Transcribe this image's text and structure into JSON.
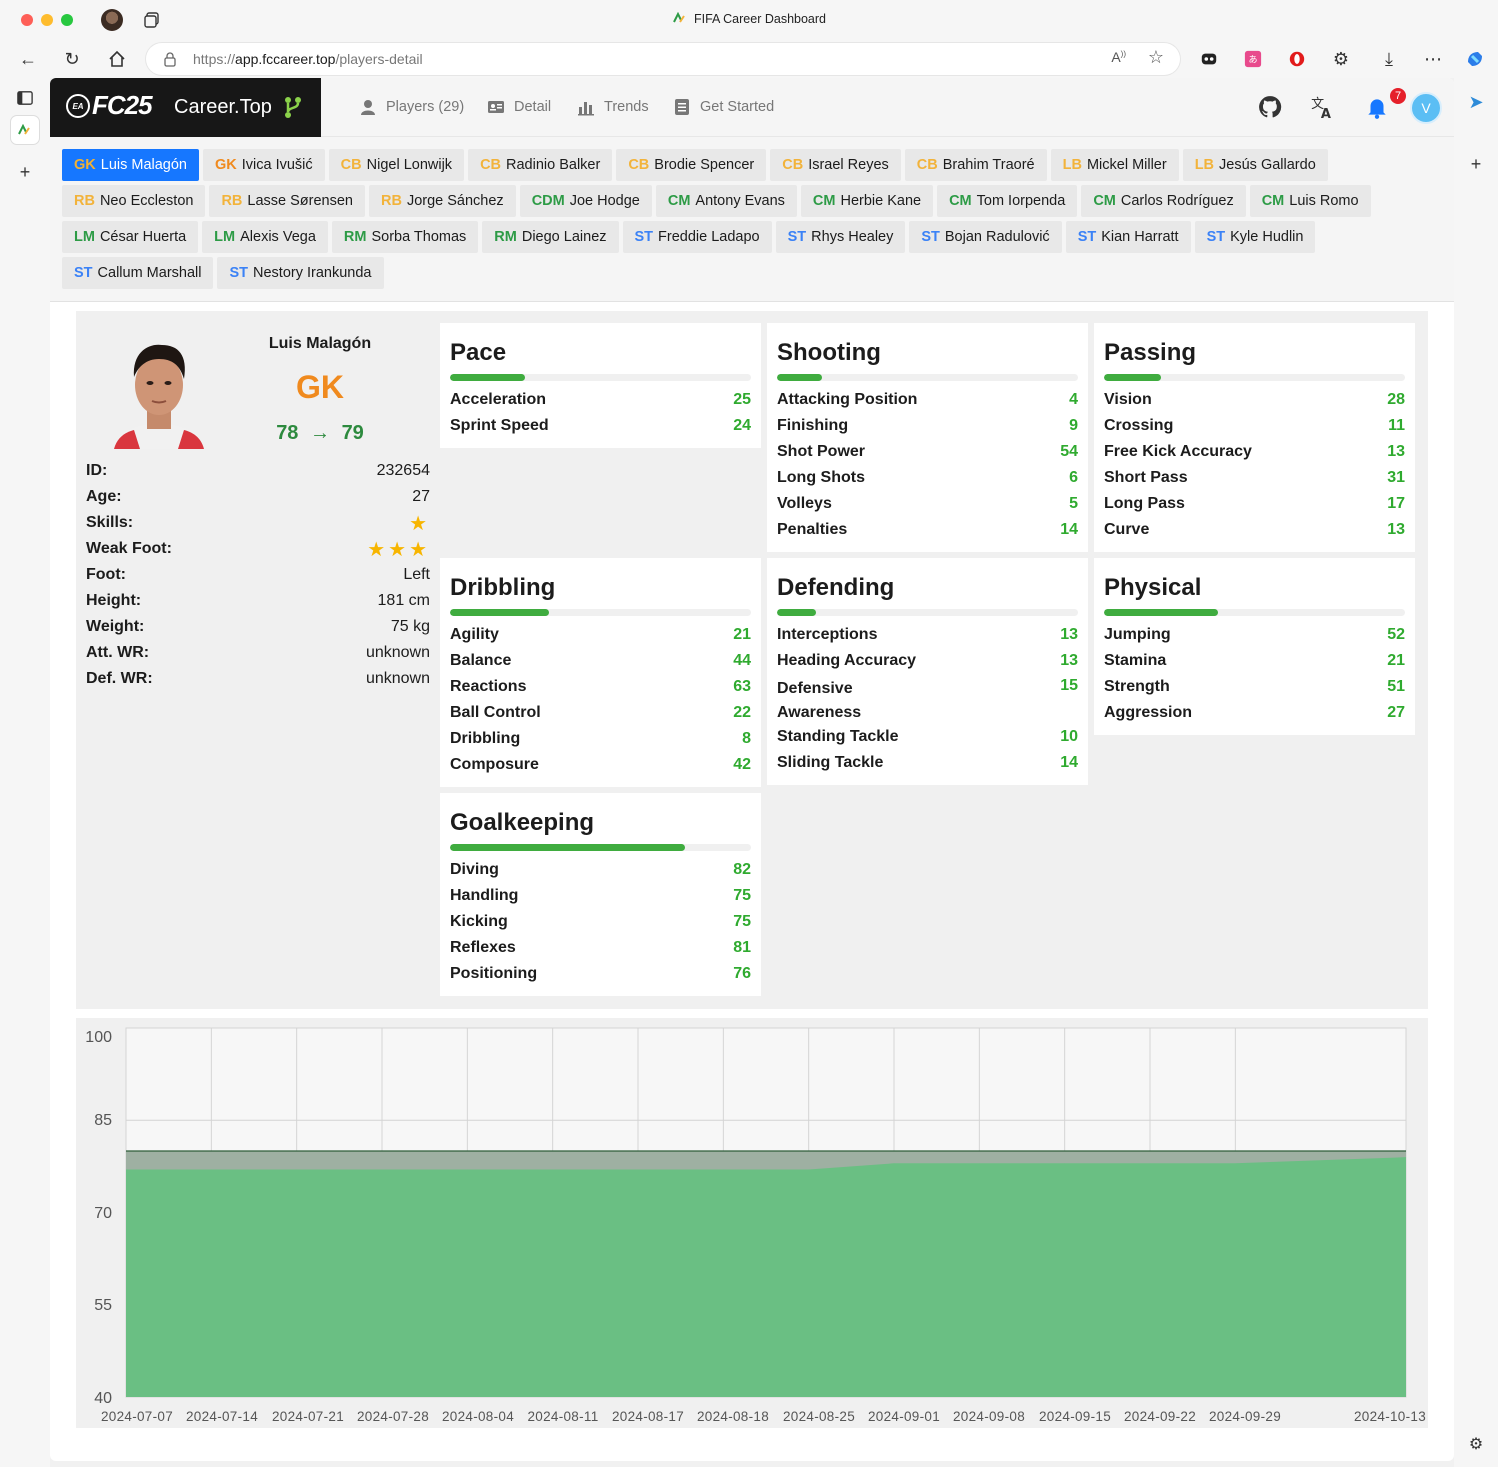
{
  "browser": {
    "window_title": "FIFA Career Dashboard",
    "url_scheme": "https://",
    "url_host": "app.fccareer.top",
    "url_path": "/players-detail"
  },
  "header": {
    "logo_mark": "EA",
    "logo_fc": "FC25",
    "logo_text": "Career.Top",
    "nav": [
      {
        "label": "Players (29)",
        "icon": "user-icon"
      },
      {
        "label": "Detail",
        "icon": "id-card-icon"
      },
      {
        "label": "Trends",
        "icon": "bar-chart-icon"
      },
      {
        "label": "Get Started",
        "icon": "document-icon"
      }
    ],
    "notification_count": "7",
    "avatar_initial": "V"
  },
  "players": [
    {
      "pos": "GK",
      "name": "Luis Malagón",
      "active": true
    },
    {
      "pos": "GK",
      "name": "Ivica Ivušić"
    },
    {
      "pos": "CB",
      "name": "Nigel Lonwijk"
    },
    {
      "pos": "CB",
      "name": "Radinio Balker"
    },
    {
      "pos": "CB",
      "name": "Brodie Spencer"
    },
    {
      "pos": "CB",
      "name": "Israel Reyes"
    },
    {
      "pos": "CB",
      "name": "Brahim Traoré"
    },
    {
      "pos": "LB",
      "name": "Mickel Miller"
    },
    {
      "pos": "LB",
      "name": "Jesús Gallardo"
    },
    {
      "pos": "RB",
      "name": "Neo Eccleston"
    },
    {
      "pos": "RB",
      "name": "Lasse Sørensen"
    },
    {
      "pos": "RB",
      "name": "Jorge Sánchez"
    },
    {
      "pos": "CDM",
      "name": "Joe Hodge"
    },
    {
      "pos": "CM",
      "name": "Antony Evans"
    },
    {
      "pos": "CM",
      "name": "Herbie Kane"
    },
    {
      "pos": "CM",
      "name": "Tom Iorpenda"
    },
    {
      "pos": "CM",
      "name": "Carlos Rodríguez"
    },
    {
      "pos": "CM",
      "name": "Luis Romo"
    },
    {
      "pos": "LM",
      "name": "César Huerta"
    },
    {
      "pos": "LM",
      "name": "Alexis Vega"
    },
    {
      "pos": "RM",
      "name": "Sorba Thomas"
    },
    {
      "pos": "RM",
      "name": "Diego Lainez"
    },
    {
      "pos": "ST",
      "name": "Freddie Ladapo"
    },
    {
      "pos": "ST",
      "name": "Rhys Healey"
    },
    {
      "pos": "ST",
      "name": "Bojan Radulović"
    },
    {
      "pos": "ST",
      "name": "Kian Harratt"
    },
    {
      "pos": "ST",
      "name": "Kyle Hudlin"
    },
    {
      "pos": "ST",
      "name": "Callum Marshall"
    },
    {
      "pos": "ST",
      "name": "Nestory Irankunda"
    }
  ],
  "profile": {
    "name": "Luis Malagón",
    "position": "GK",
    "ovr_from": "78",
    "ovr_arrow": "→",
    "ovr_to": "79",
    "info": [
      {
        "key": "ID:",
        "value": "232654"
      },
      {
        "key": "Age:",
        "value": "27"
      },
      {
        "key": "Skills:",
        "stars": 1
      },
      {
        "key": "Weak Foot:",
        "stars": 3
      },
      {
        "key": "Foot:",
        "value": "Left"
      },
      {
        "key": "Height:",
        "value": "181 cm"
      },
      {
        "key": "Weight:",
        "value": "75 kg"
      },
      {
        "key": "Att. WR:",
        "value": "unknown"
      },
      {
        "key": "Def. WR:",
        "value": "unknown"
      }
    ]
  },
  "stat_groups": [
    {
      "title": "Pace",
      "level": 25,
      "stats": [
        [
          "Acceleration",
          25
        ],
        [
          "Sprint Speed",
          24
        ]
      ]
    },
    {
      "title": "Shooting",
      "level": 15,
      "stats": [
        [
          "Attacking Position",
          4
        ],
        [
          "Finishing",
          9
        ],
        [
          "Shot Power",
          54
        ],
        [
          "Long Shots",
          6
        ],
        [
          "Volleys",
          5
        ],
        [
          "Penalties",
          14
        ]
      ]
    },
    {
      "title": "Passing",
      "level": 19,
      "stats": [
        [
          "Vision",
          28
        ],
        [
          "Crossing",
          11
        ],
        [
          "Free Kick Accuracy",
          13
        ],
        [
          "Short Pass",
          31
        ],
        [
          "Long Pass",
          17
        ],
        [
          "Curve",
          13
        ]
      ]
    },
    {
      "title": "Dribbling",
      "level": 33,
      "stats": [
        [
          "Agility",
          21
        ],
        [
          "Balance",
          44
        ],
        [
          "Reactions",
          63
        ],
        [
          "Ball Control",
          22
        ],
        [
          "Dribbling",
          8
        ],
        [
          "Composure",
          42
        ]
      ]
    },
    {
      "title": "Defending",
      "level": 13,
      "stats": [
        [
          "Interceptions",
          13
        ],
        [
          "Heading Accuracy",
          13
        ],
        [
          "Defensive Awareness",
          15
        ],
        [
          "Standing Tackle",
          10
        ],
        [
          "Sliding Tackle",
          14
        ]
      ]
    },
    {
      "title": "Physical",
      "level": 38,
      "stats": [
        [
          "Jumping",
          52
        ],
        [
          "Stamina",
          21
        ],
        [
          "Strength",
          51
        ],
        [
          "Aggression",
          27
        ]
      ]
    },
    {
      "title": "Goalkeeping",
      "level": 78,
      "stats": [
        [
          "Diving",
          82
        ],
        [
          "Handling",
          75
        ],
        [
          "Kicking",
          75
        ],
        [
          "Reflexes",
          81
        ],
        [
          "Positioning",
          76
        ]
      ]
    }
  ],
  "colors": {
    "accent": "#1677ff",
    "stat_green": "#2faa2f",
    "bar_green": "#3fac3f",
    "chart_fill": "#6abf83",
    "chart_potential": "#9eb0a2"
  },
  "chart_data": {
    "type": "area",
    "x": [
      "2024-07-07",
      "2024-07-14",
      "2024-07-21",
      "2024-07-28",
      "2024-08-04",
      "2024-08-11",
      "2024-08-17",
      "2024-08-18",
      "2024-08-25",
      "2024-09-01",
      "2024-09-08",
      "2024-09-15",
      "2024-09-22",
      "2024-09-29",
      "2024-10-13"
    ],
    "series": [
      {
        "values": [
          80,
          80,
          80,
          80,
          80,
          80,
          80,
          80,
          80,
          80,
          80,
          80,
          80,
          80,
          80
        ]
      },
      {
        "values": [
          77,
          77,
          77,
          77,
          77,
          77,
          77,
          77,
          77,
          78,
          78,
          78,
          78,
          78,
          79
        ]
      }
    ],
    "y_ticks": [
      40,
      55,
      70,
      85,
      100
    ],
    "ylim": [
      40,
      100
    ],
    "grid": true,
    "title": "",
    "xlabel": "",
    "ylabel": ""
  }
}
